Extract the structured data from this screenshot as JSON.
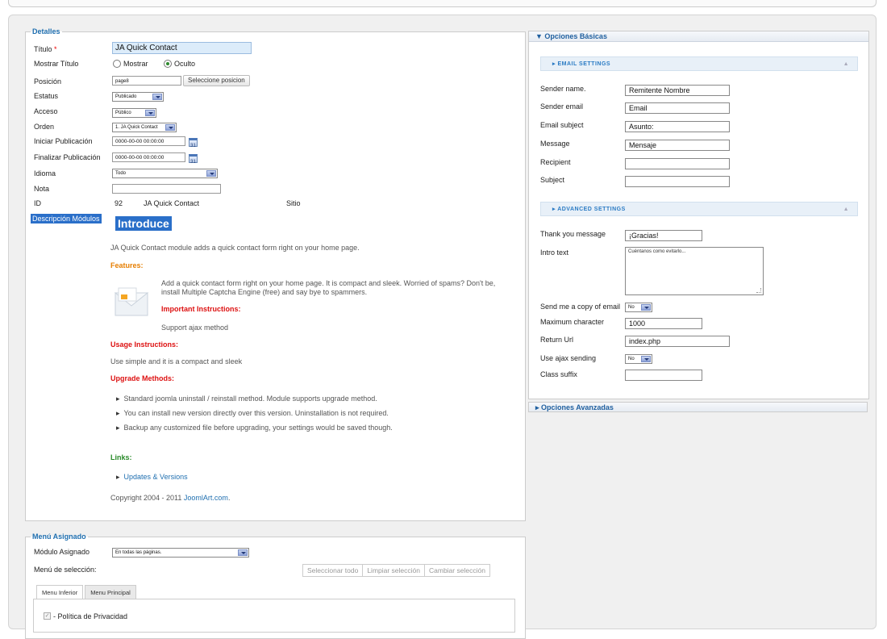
{
  "details": {
    "legend": "Detalles",
    "title_label": "Título",
    "required_mark": "*",
    "title_value": "JA Quick Contact",
    "show_title_label": "Mostrar Título",
    "show_option": "Mostrar",
    "hide_option": "Oculto",
    "position_label": "Posición",
    "position_value": "page8",
    "select_position_button": "Seleccione posicion",
    "status_label": "Estatus",
    "status_value": "Publicado",
    "access_label": "Acceso",
    "access_value": "Público",
    "order_label": "Orden",
    "order_value": "1. JA Quick Contact",
    "start_pub_label": "Iniciar Publicación",
    "start_pub_value": "0000-00-00 00:00:00",
    "end_pub_label": "Finalizar Publicación",
    "end_pub_value": "0000-00-00 00:00:00",
    "calendar_icon_text": "31",
    "language_label": "Idioma",
    "language_value": "Todo",
    "note_label": "Nota",
    "note_value": "",
    "id_label": "ID",
    "id_value": "92",
    "id_name": "JA Quick Contact",
    "id_site": "Sitio",
    "description_label": "Descripción Módulos"
  },
  "description": {
    "title": "Introduce",
    "intro": "JA Quick Contact module adds a quick contact form right on your home page.",
    "features_heading": "Features:",
    "features_text_1": "Add a quick contact form right on your home page. It is compact and sleek. Worried of spams? Don't be,",
    "features_text_2": "install Multiple Captcha Engine (free) and say bye to spammers.",
    "important_heading": "Important Instructions:",
    "important_text": "Support ajax method",
    "usage_heading": "Usage Instructions:",
    "usage_text": "Use simple and it is a compact and sleek",
    "upgrade_heading": "Upgrade Methods:",
    "upgrade_items": [
      "Standard joomla uninstall / reinstall method. Module supports upgrade method.",
      "You can install new version directly over this version. Uninstallation is not required.",
      "Backup any customized file before upgrading, your settings would be saved though."
    ],
    "links_heading": "Links:",
    "links_item": "Updates & Versions",
    "copyright_prefix": "Copyright 2004 - 2011",
    "copyright_link": "JoomlArt.com",
    "copyright_suffix": "."
  },
  "menu_assign": {
    "legend": "Menú Asignado",
    "module_assigned_label": "Módulo Asignado",
    "module_assigned_value": "En todas las páginas.",
    "selection_label": "Menú de selección:",
    "buttons": [
      "Seleccionar todo",
      "Limpiar selección",
      "Cambiar selección"
    ],
    "tabs": [
      "Menu Inferior",
      "Menu Principal"
    ],
    "first_item": "- Política de Privacidad"
  },
  "basic_options": {
    "header": "▼ Opciones Básicas",
    "email_settings": "▸ EMAIL SETTINGS",
    "advanced_settings": "▸ ADVANCED SETTINGS",
    "collapse_caret": "▲",
    "fields": {
      "sender_name_label": "Sender name.",
      "sender_name_value": "Remitente Nombre",
      "sender_email_label": "Sender email",
      "sender_email_value": "Email",
      "email_subject_label": "Email subject",
      "email_subject_value": "Asunto:",
      "message_label": "Message",
      "message_value": "Mensaje",
      "recipient_label": "Recipient",
      "recipient_value": "",
      "subject_label": "Subject",
      "subject_value": "",
      "thank_you_label": "Thank you message",
      "thank_you_value": "¡Gracias!",
      "intro_text_label": "Intro text",
      "intro_text_value": "Cuéntanos como evitarlo...",
      "send_copy_label": "Send me a copy of email",
      "send_copy_value": "No",
      "max_char_label": "Maximum character",
      "max_char_value": "1000",
      "return_url_label": "Return Url",
      "return_url_value": "index.php",
      "use_ajax_label": "Use ajax sending",
      "use_ajax_value": "No",
      "class_suffix_label": "Class suffix",
      "class_suffix_value": ""
    }
  },
  "advanced_options": {
    "header": "▸ Opciones Avanzadas"
  }
}
